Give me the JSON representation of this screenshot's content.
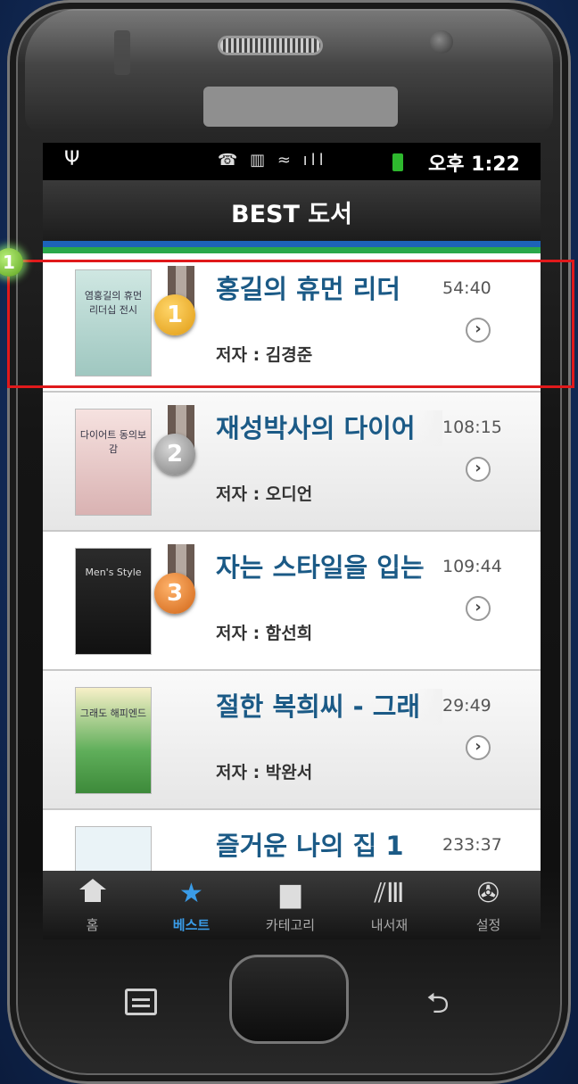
{
  "status_bar": {
    "usb": "Ψ",
    "icons": "☎ ▥ ≈ ıll",
    "time": "오후 1:22"
  },
  "header": {
    "title": "BEST 도서"
  },
  "books": [
    {
      "rank": "1",
      "title": "홍길의 휴먼 리더",
      "duration": "54:40",
      "author": "저자 : 김경준",
      "cover_text": "염홍길의 휴먼 리더십 전시"
    },
    {
      "rank": "2",
      "title": "재성박사의 다이어",
      "duration": "108:15",
      "author": "저자 : 오디언",
      "cover_text": "다이어트 동의보감"
    },
    {
      "rank": "3",
      "title": "자는 스타일을 입는",
      "duration": "109:44",
      "author": "저자 : 함선희",
      "cover_text": "Men's Style"
    },
    {
      "rank": "",
      "title": "절한 복희씨 - 그래",
      "duration": "29:49",
      "author": "저자 : 박완서",
      "cover_text": "그래도 해피엔드"
    },
    {
      "rank": "",
      "title": "즐거운 나의 집 1",
      "duration": "233:37",
      "author": "",
      "cover_text": ""
    }
  ],
  "tabs": [
    {
      "label": "홈",
      "icon": "home-icon"
    },
    {
      "label": "베스트",
      "icon": "star-icon"
    },
    {
      "label": "카테고리",
      "icon": "folder-icon"
    },
    {
      "label": "내서재",
      "icon": "bookshelf-icon"
    },
    {
      "label": "설정",
      "icon": "wrench-icon"
    }
  ],
  "annotation": {
    "badge": "1"
  },
  "colors": {
    "accent_blue": "#3a9ce8",
    "title_blue": "#1b5a86",
    "highlight_red": "#e0191b"
  }
}
